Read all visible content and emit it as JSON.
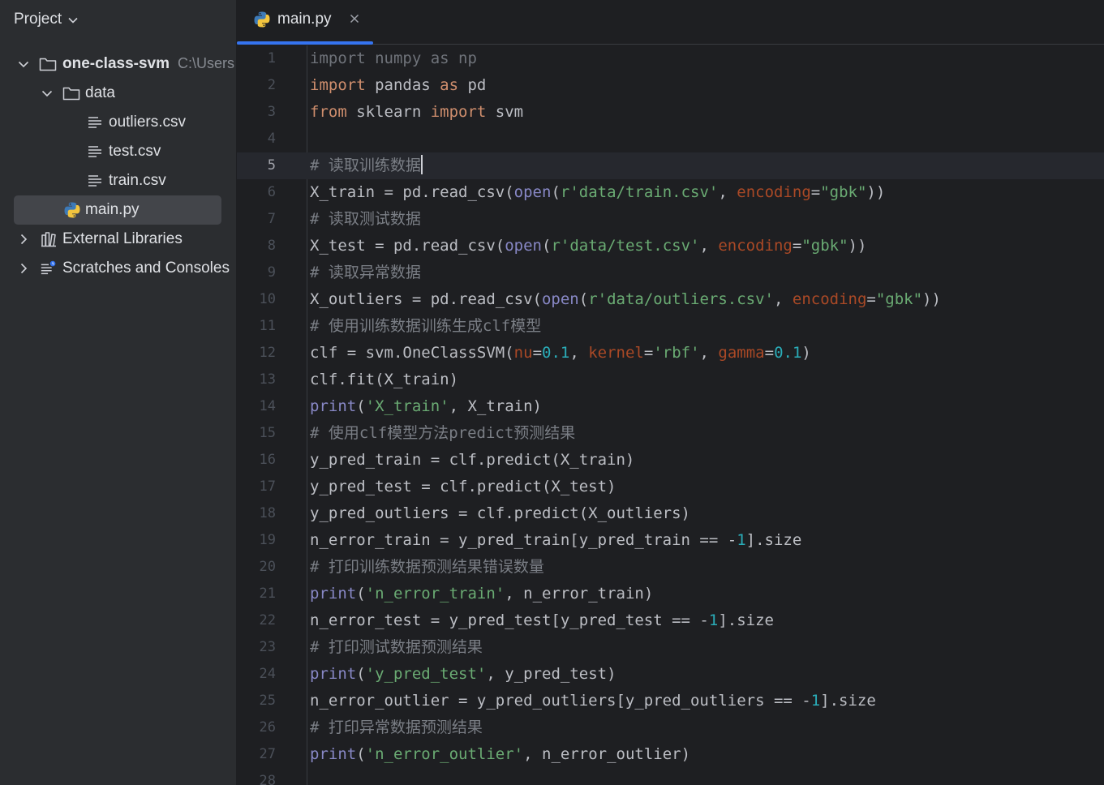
{
  "project_panel": {
    "title": "Project",
    "tree": [
      {
        "label": "one-class-svm",
        "hint": "C:\\Users",
        "type": "folder",
        "expanded": true,
        "depth": 0
      },
      {
        "label": "data",
        "type": "folder",
        "expanded": true,
        "depth": 1
      },
      {
        "label": "outliers.csv",
        "type": "text-file",
        "depth": 2
      },
      {
        "label": "test.csv",
        "type": "text-file",
        "depth": 2
      },
      {
        "label": "train.csv",
        "type": "text-file",
        "depth": 2
      },
      {
        "label": "main.py",
        "type": "python-file",
        "depth": 1,
        "selected": true
      },
      {
        "label": "External Libraries",
        "type": "library",
        "expanded": false,
        "depth": 0
      },
      {
        "label": "Scratches and Consoles",
        "type": "scratches",
        "expanded": false,
        "depth": 0
      }
    ]
  },
  "editor": {
    "tab": {
      "label": "main.py",
      "active": true
    },
    "current_line": 5,
    "lines": [
      {
        "n": "1",
        "tokens": [
          [
            "dim",
            "import numpy as np"
          ]
        ]
      },
      {
        "n": "2",
        "tokens": [
          [
            "k",
            "import"
          ],
          [
            "m",
            " pandas "
          ],
          [
            "k",
            "as"
          ],
          [
            "m",
            " pd"
          ]
        ]
      },
      {
        "n": "3",
        "tokens": [
          [
            "k",
            "from"
          ],
          [
            "m",
            " sklearn "
          ],
          [
            "k",
            "import"
          ],
          [
            "m",
            " svm"
          ]
        ]
      },
      {
        "n": "4",
        "tokens": []
      },
      {
        "n": "5",
        "tokens": [
          [
            "c",
            "# 读取训练数据"
          ]
        ],
        "caret": true
      },
      {
        "n": "6",
        "tokens": [
          [
            "m",
            "X_train = pd.read_csv("
          ],
          [
            "bi",
            "open"
          ],
          [
            "m",
            "("
          ],
          [
            "s",
            "r'data/train.csv'"
          ],
          [
            "m",
            ", "
          ],
          [
            "kw",
            "encoding"
          ],
          [
            "m",
            "="
          ],
          [
            "s",
            "\"gbk\""
          ],
          [
            "m",
            "))"
          ]
        ]
      },
      {
        "n": "7",
        "tokens": [
          [
            "c",
            "# 读取测试数据"
          ]
        ]
      },
      {
        "n": "8",
        "tokens": [
          [
            "m",
            "X_test = pd.read_csv("
          ],
          [
            "bi",
            "open"
          ],
          [
            "m",
            "("
          ],
          [
            "s",
            "r'data/test.csv'"
          ],
          [
            "m",
            ", "
          ],
          [
            "kw",
            "encoding"
          ],
          [
            "m",
            "="
          ],
          [
            "s",
            "\"gbk\""
          ],
          [
            "m",
            "))"
          ]
        ]
      },
      {
        "n": "9",
        "tokens": [
          [
            "c",
            "# 读取异常数据"
          ]
        ]
      },
      {
        "n": "10",
        "tokens": [
          [
            "m",
            "X_outliers = pd.read_csv("
          ],
          [
            "bi",
            "open"
          ],
          [
            "m",
            "("
          ],
          [
            "s",
            "r'data/outliers.csv'"
          ],
          [
            "m",
            ", "
          ],
          [
            "kw",
            "encoding"
          ],
          [
            "m",
            "="
          ],
          [
            "s",
            "\"gbk\""
          ],
          [
            "m",
            "))"
          ]
        ]
      },
      {
        "n": "11",
        "tokens": [
          [
            "c",
            "# 使用训练数据训练生成clf模型"
          ]
        ]
      },
      {
        "n": "12",
        "tokens": [
          [
            "m",
            "clf = svm.OneClassSVM("
          ],
          [
            "kw",
            "nu"
          ],
          [
            "m",
            "="
          ],
          [
            "n",
            "0.1"
          ],
          [
            "m",
            ", "
          ],
          [
            "kw",
            "kernel"
          ],
          [
            "m",
            "="
          ],
          [
            "s",
            "'rbf'"
          ],
          [
            "m",
            ", "
          ],
          [
            "kw",
            "gamma"
          ],
          [
            "m",
            "="
          ],
          [
            "n",
            "0.1"
          ],
          [
            "m",
            ")"
          ]
        ]
      },
      {
        "n": "13",
        "tokens": [
          [
            "m",
            "clf.fit(X_train)"
          ]
        ]
      },
      {
        "n": "14",
        "tokens": [
          [
            "bi",
            "print"
          ],
          [
            "m",
            "("
          ],
          [
            "s",
            "'X_train'"
          ],
          [
            "m",
            ", X_train)"
          ]
        ]
      },
      {
        "n": "15",
        "tokens": [
          [
            "c",
            "# 使用clf模型方法predict预测结果"
          ]
        ]
      },
      {
        "n": "16",
        "tokens": [
          [
            "m",
            "y_pred_train = clf.predict(X_train)"
          ]
        ]
      },
      {
        "n": "17",
        "tokens": [
          [
            "m",
            "y_pred_test = clf.predict(X_test)"
          ]
        ]
      },
      {
        "n": "18",
        "tokens": [
          [
            "m",
            "y_pred_outliers = clf.predict(X_outliers)"
          ]
        ]
      },
      {
        "n": "19",
        "tokens": [
          [
            "m",
            "n_error_train = y_pred_train[y_pred_train == -"
          ],
          [
            "n",
            "1"
          ],
          [
            "m",
            "].size"
          ]
        ]
      },
      {
        "n": "20",
        "tokens": [
          [
            "c",
            "# 打印训练数据预测结果错误数量"
          ]
        ]
      },
      {
        "n": "21",
        "tokens": [
          [
            "bi",
            "print"
          ],
          [
            "m",
            "("
          ],
          [
            "s",
            "'n_error_train'"
          ],
          [
            "m",
            ", n_error_train)"
          ]
        ]
      },
      {
        "n": "22",
        "tokens": [
          [
            "m",
            "n_error_test = y_pred_test[y_pred_test == -"
          ],
          [
            "n",
            "1"
          ],
          [
            "m",
            "].size"
          ]
        ]
      },
      {
        "n": "23",
        "tokens": [
          [
            "c",
            "# 打印测试数据预测结果"
          ]
        ]
      },
      {
        "n": "24",
        "tokens": [
          [
            "bi",
            "print"
          ],
          [
            "m",
            "("
          ],
          [
            "s",
            "'y_pred_test'"
          ],
          [
            "m",
            ", y_pred_test)"
          ]
        ]
      },
      {
        "n": "25",
        "tokens": [
          [
            "m",
            "n_error_outlier = y_pred_outliers[y_pred_outliers == -"
          ],
          [
            "n",
            "1"
          ],
          [
            "m",
            "].size"
          ]
        ]
      },
      {
        "n": "26",
        "tokens": [
          [
            "c",
            "# 打印异常数据预测结果"
          ]
        ]
      },
      {
        "n": "27",
        "tokens": [
          [
            "bi",
            "print"
          ],
          [
            "m",
            "("
          ],
          [
            "s",
            "'n_error_outlier'"
          ],
          [
            "m",
            ", n_error_outlier)"
          ]
        ]
      },
      {
        "n": "28",
        "tokens": []
      }
    ]
  }
}
